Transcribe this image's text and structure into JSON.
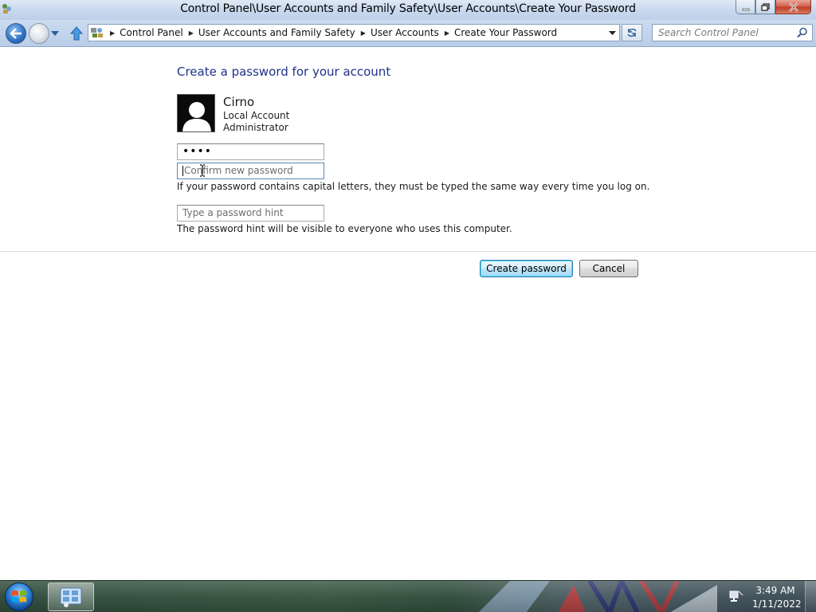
{
  "window": {
    "title": "Control Panel\\User Accounts and Family Safety\\User Accounts\\Create Your Password",
    "icon": "control-panel-icon",
    "controls": [
      "minimize",
      "maximize",
      "close"
    ]
  },
  "navigation": {
    "breadcrumbs": [
      "Control Panel",
      "User Accounts and Family Safety",
      "User Accounts",
      "Create Your Password"
    ],
    "search_placeholder": "Search Control Panel"
  },
  "main": {
    "heading": "Create a password for your account",
    "user": {
      "name": "Cirno",
      "account_type": "Local Account",
      "role": "Administrator"
    },
    "new_password_value": "••••",
    "confirm_placeholder": "Confirm new password",
    "case_note": "If your password contains capital letters, they must be typed the same way every time you log on.",
    "hint_placeholder": "Type a password hint",
    "hint_note": "The password hint will be visible to everyone who uses this computer.",
    "buttons": {
      "create": "Create password",
      "cancel": "Cancel"
    }
  },
  "taskbar": {
    "time": "3:49 AM",
    "date": "1/11/2022"
  },
  "colors": {
    "heading": "#1e3287",
    "titlebar": "#c9d9ee",
    "default_button_border": "#3c7fb1"
  }
}
